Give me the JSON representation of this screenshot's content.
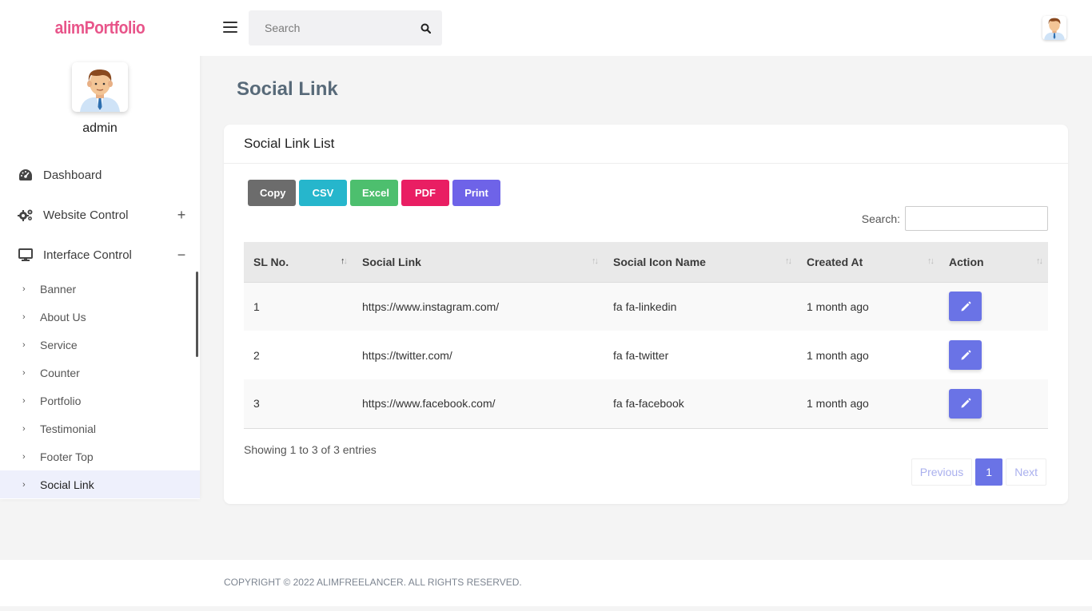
{
  "brand": {
    "name": "alimPortfolio",
    "color": "#e8558a"
  },
  "profile": {
    "name": "admin"
  },
  "sidebar": {
    "items": [
      {
        "label": "Dashboard",
        "icon": "dashboard-icon",
        "toggle": ""
      },
      {
        "label": "Website Control",
        "icon": "gears-icon",
        "toggle": "+"
      },
      {
        "label": "Interface Control",
        "icon": "monitor-icon",
        "toggle": "−"
      }
    ],
    "sub_items": [
      {
        "label": "Banner"
      },
      {
        "label": "About Us"
      },
      {
        "label": "Service"
      },
      {
        "label": "Counter"
      },
      {
        "label": "Portfolio"
      },
      {
        "label": "Testimonial"
      },
      {
        "label": "Footer Top"
      },
      {
        "label": "Social Link",
        "active": true
      }
    ]
  },
  "topbar": {
    "search_placeholder": "Search"
  },
  "page": {
    "title": "Social Link"
  },
  "card": {
    "title": "Social Link List",
    "buttons": {
      "copy": "Copy",
      "csv": "CSV",
      "excel": "Excel",
      "pdf": "PDF",
      "print": "Print"
    },
    "search_label": "Search:",
    "table": {
      "headers": [
        "SL No.",
        "Social Link",
        "Social Icon Name",
        "Created At",
        "Action"
      ],
      "rows": [
        {
          "sl": "1",
          "link": "https://www.instagram.com/",
          "icon": "fa fa-linkedin",
          "created": "1 month ago"
        },
        {
          "sl": "2",
          "link": "https://twitter.com/",
          "icon": "fa fa-twitter",
          "created": "1 month ago"
        },
        {
          "sl": "3",
          "link": "https://www.facebook.com/",
          "icon": "fa fa-facebook",
          "created": "1 month ago"
        }
      ]
    },
    "info": "Showing 1 to 3 of 3 entries",
    "pagination": {
      "previous": "Previous",
      "page": "1",
      "next": "Next"
    }
  },
  "footer": {
    "text": "COPYRIGHT © 2022 ALIMFREELANCER. ALL RIGHTS RESERVED."
  },
  "colors": {
    "accent": "#6a73e6",
    "copy": "#6c6c6c",
    "csv": "#26b6cc",
    "excel": "#4dbf6e",
    "pdf": "#e91e63",
    "print": "#6e63e8"
  }
}
